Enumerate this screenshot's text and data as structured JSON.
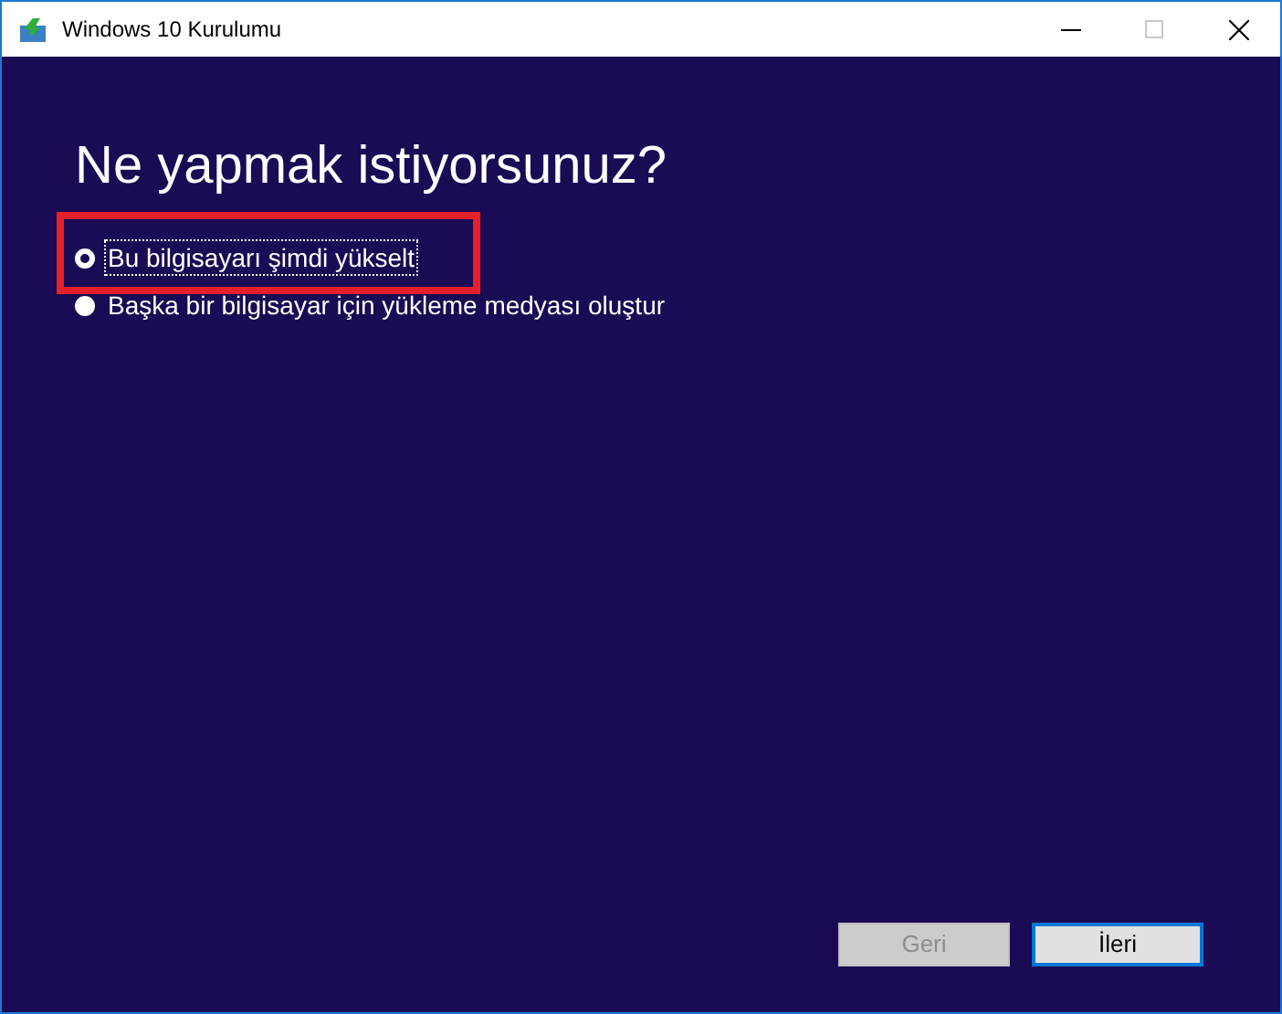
{
  "window": {
    "title": "Windows 10 Kurulumu"
  },
  "heading": "Ne yapmak istiyorsunuz?",
  "options": [
    {
      "label": "Bu bilgisayarı şimdi yükselt",
      "selected": true,
      "highlighted": true
    },
    {
      "label": "Başka bir bilgisayar için yükleme medyası oluştur",
      "selected": false,
      "highlighted": false
    }
  ],
  "buttons": [
    {
      "label": "Geri",
      "disabled": true,
      "focused": false
    },
    {
      "label": "İleri",
      "disabled": false,
      "focused": true
    }
  ]
}
